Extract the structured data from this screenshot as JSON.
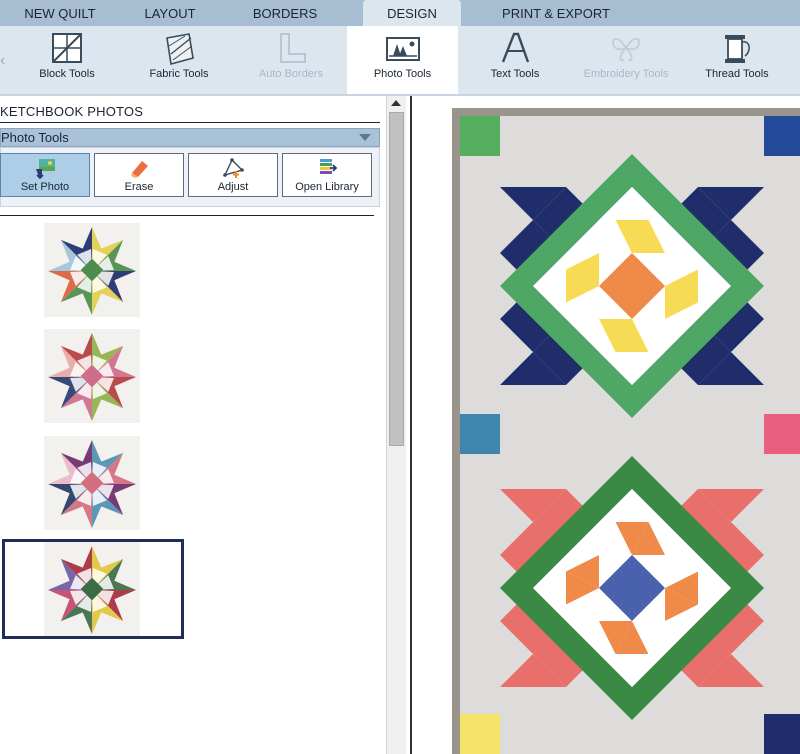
{
  "tabs": [
    {
      "label": "NEW QUILT"
    },
    {
      "label": "LAYOUT"
    },
    {
      "label": "BORDERS"
    },
    {
      "label": "DESIGN"
    },
    {
      "label": "PRINT & EXPORT"
    }
  ],
  "active_tab": "DESIGN",
  "toolbar": {
    "items": [
      {
        "label": "Block Tools",
        "icon": "block-tools-icon"
      },
      {
        "label": "Fabric Tools",
        "icon": "fabric-tools-icon"
      },
      {
        "label": "Auto Borders",
        "icon": "auto-borders-icon",
        "disabled": true
      },
      {
        "label": "Photo Tools",
        "icon": "photo-tools-icon",
        "active": true
      },
      {
        "label": "Text Tools",
        "icon": "text-tools-icon"
      },
      {
        "label": "Embroidery Tools",
        "icon": "embroidery-tools-icon",
        "disabled": true
      },
      {
        "label": "Thread Tools",
        "icon": "thread-tools-icon"
      }
    ]
  },
  "panel": {
    "title": "KETCHBOOK PHOTOS",
    "section": "Photo Tools",
    "buttons": [
      {
        "label": "Set Photo",
        "icon": "set-photo-icon",
        "active": true
      },
      {
        "label": "Erase",
        "icon": "erase-icon"
      },
      {
        "label": "Adjust",
        "icon": "adjust-icon"
      },
      {
        "label": "Open Library",
        "icon": "open-library-icon"
      }
    ],
    "photos": [
      {
        "palette": [
          "#1f2d6b",
          "#e2cf4a",
          "#4d8c4a",
          "#d9603b",
          "#9ec3d8"
        ]
      },
      {
        "palette": [
          "#b53d3d",
          "#8fb24a",
          "#cf6d8a",
          "#2a3a6b",
          "#e8a7a7"
        ]
      },
      {
        "palette": [
          "#6e2a6b",
          "#4f8fb0",
          "#d26e7d",
          "#223b63",
          "#e9b8c8"
        ]
      },
      {
        "palette": [
          "#a52c3b",
          "#e3c43c",
          "#3d6b45",
          "#c2476e",
          "#6e5aa0"
        ]
      }
    ],
    "selected_photo": 4
  },
  "colors": {
    "quilt_background": "#dedcdb",
    "quilt_border": "#9a958c",
    "navy": "#1f2d6b",
    "green": "#4fa765",
    "yellow": "#f7db54",
    "orange": "#ef8a48",
    "red": "#e9706a",
    "dark_green": "#3a8a45",
    "blue": "#4a62ad",
    "teal": "#3f86ad",
    "pink": "#e8607e"
  }
}
